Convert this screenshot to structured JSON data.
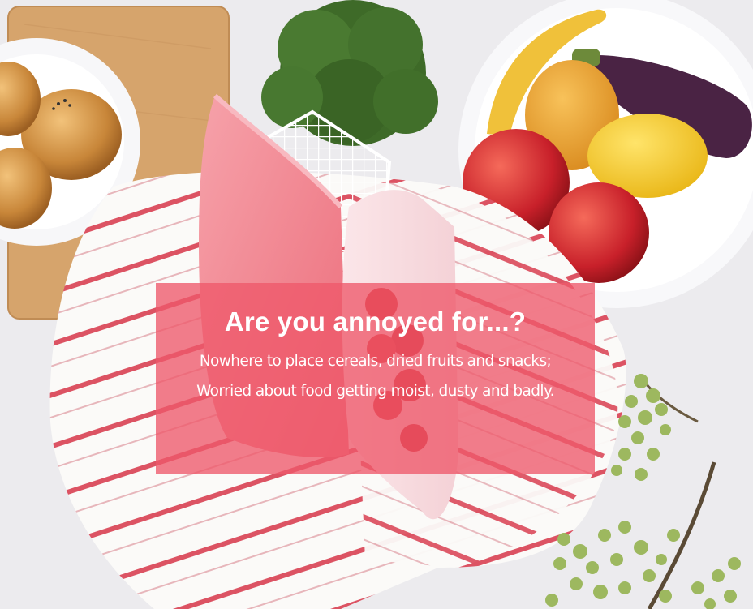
{
  "banner": {
    "headline": "Are you annoyed for...?",
    "body": "Nowhere to place cereals, dried fruits and snacks; Worried about food getting moist, dusty and badly.",
    "overlay_color": "#ee586a"
  },
  "colors": {
    "bag_pink": "#f07b86",
    "stripe_red": "#d9485a",
    "board_wood": "#d7a66e",
    "broccoli_green": "#3f6b2a"
  }
}
